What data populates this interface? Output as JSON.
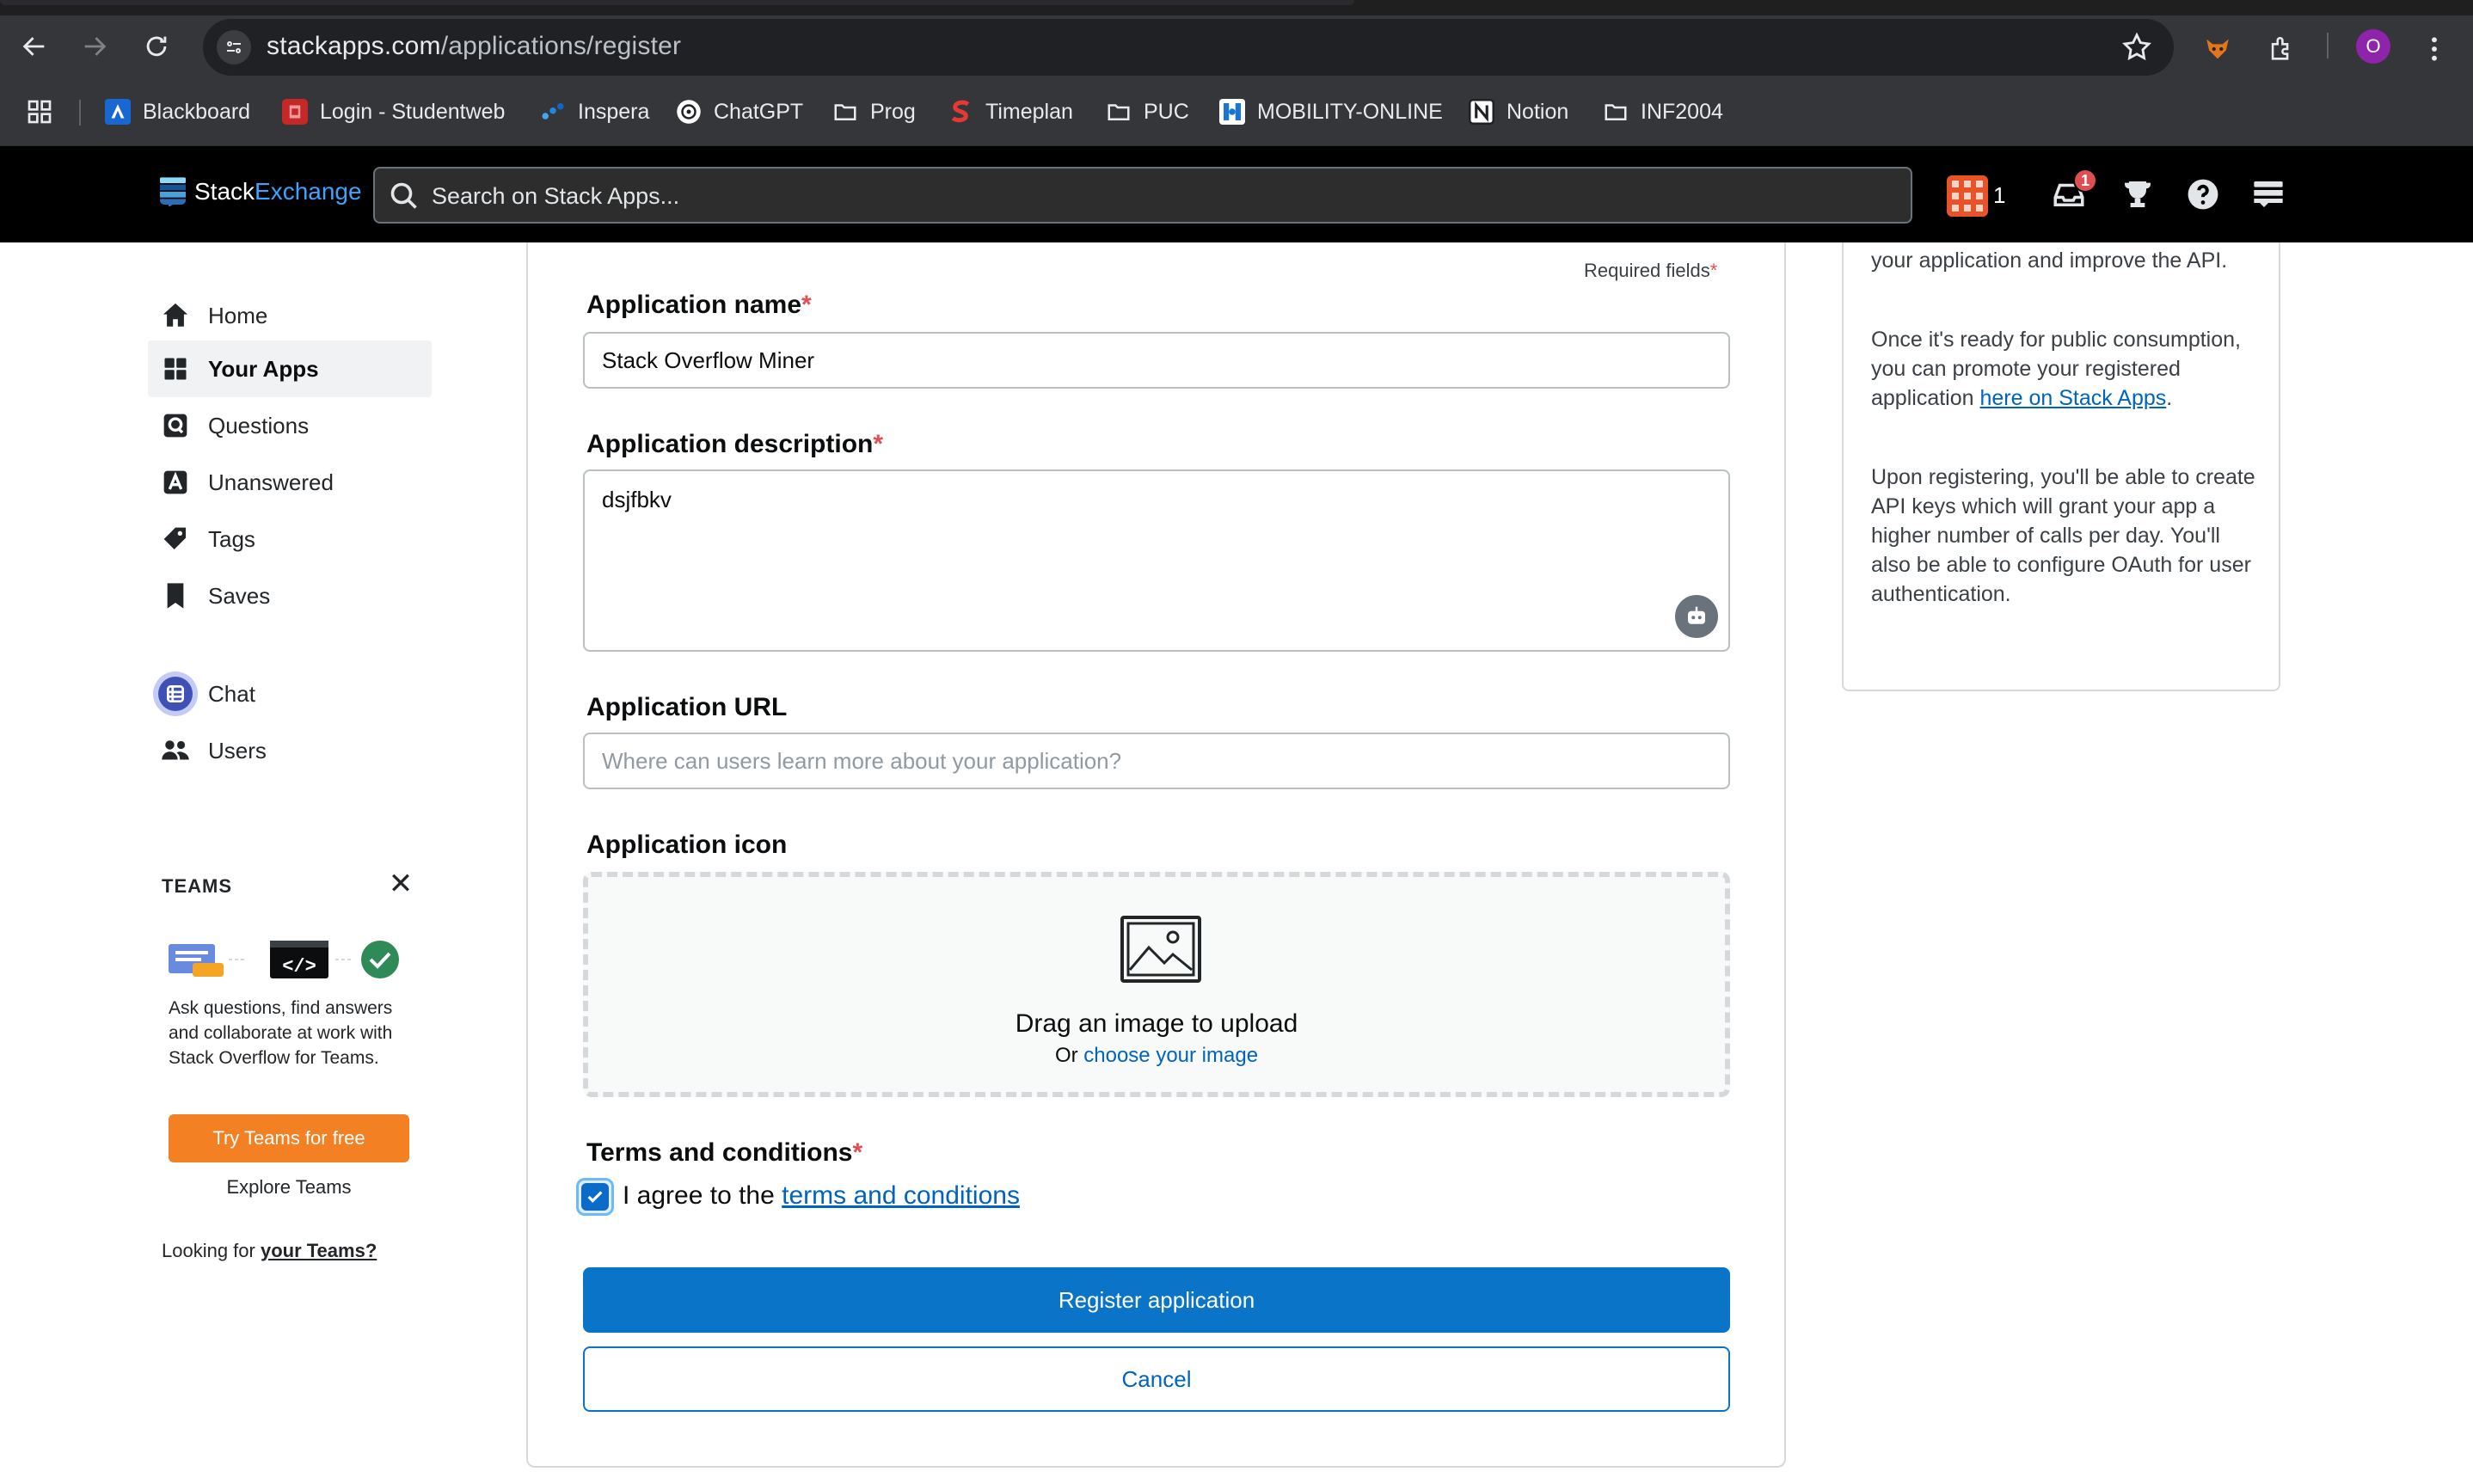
{
  "browser": {
    "url_host": "stackapps.com",
    "url_path": "/applications/register",
    "profile_initial": "O"
  },
  "bookmarks": [
    {
      "label": "Blackboard"
    },
    {
      "label": "Login - Studentweb"
    },
    {
      "label": "Inspera"
    },
    {
      "label": "ChatGPT"
    },
    {
      "label": "Prog"
    },
    {
      "label": "Timeplan"
    },
    {
      "label": "PUC"
    },
    {
      "label": "MOBILITY-ONLINE"
    },
    {
      "label": "Notion"
    },
    {
      "label": "INF2004"
    }
  ],
  "site": {
    "logo_stack": "Stack",
    "logo_exchange": "Exchange",
    "search_placeholder": "Search on Stack Apps...",
    "reputation": "1",
    "inbox_badge": "1"
  },
  "sidebar": {
    "items": [
      {
        "label": "Home"
      },
      {
        "label": "Your Apps"
      },
      {
        "label": "Questions"
      },
      {
        "label": "Unanswered"
      },
      {
        "label": "Tags"
      },
      {
        "label": "Saves"
      },
      {
        "label": "Chat"
      },
      {
        "label": "Users"
      }
    ],
    "teams": {
      "title": "TEAMS",
      "text": "Ask questions, find answers and collaborate at work with Stack Overflow for Teams.",
      "cta": "Try Teams for free",
      "explore": "Explore Teams",
      "looking_prefix": "Looking for ",
      "looking_link": "your Teams?"
    }
  },
  "form": {
    "required_note": "Required fields",
    "asterisk": "*",
    "name_label": "Application name",
    "name_value": "Stack Overflow Miner",
    "desc_label": "Application description",
    "desc_value": "dsjfbkv",
    "url_label": "Application URL",
    "url_placeholder": "Where can users learn more about your application?",
    "icon_label": "Application icon",
    "dropzone_title": "Drag an image to upload",
    "dropzone_or": "Or ",
    "dropzone_link": "choose your image",
    "terms_label": "Terms and conditions",
    "agree_text": "I agree to the ",
    "agree_link": "terms and conditions",
    "agree_checked": true,
    "submit_label": "Register application",
    "cancel_label": "Cancel"
  },
  "info": {
    "p1": "your application and improve the API.",
    "p2_before": "Once it's ready for public consumption, you can promote your registered application ",
    "p2_link": "here on Stack Apps",
    "p2_after": ".",
    "p3": "Upon registering, you'll be able to create API keys which will grant your app a higher number of calls per day. You'll also be able to configure OAuth for user authentication."
  },
  "colors": {
    "accent": "#0a74c9",
    "link": "#0063bf",
    "teams_orange": "#f48024",
    "required_red": "#de4f54"
  }
}
